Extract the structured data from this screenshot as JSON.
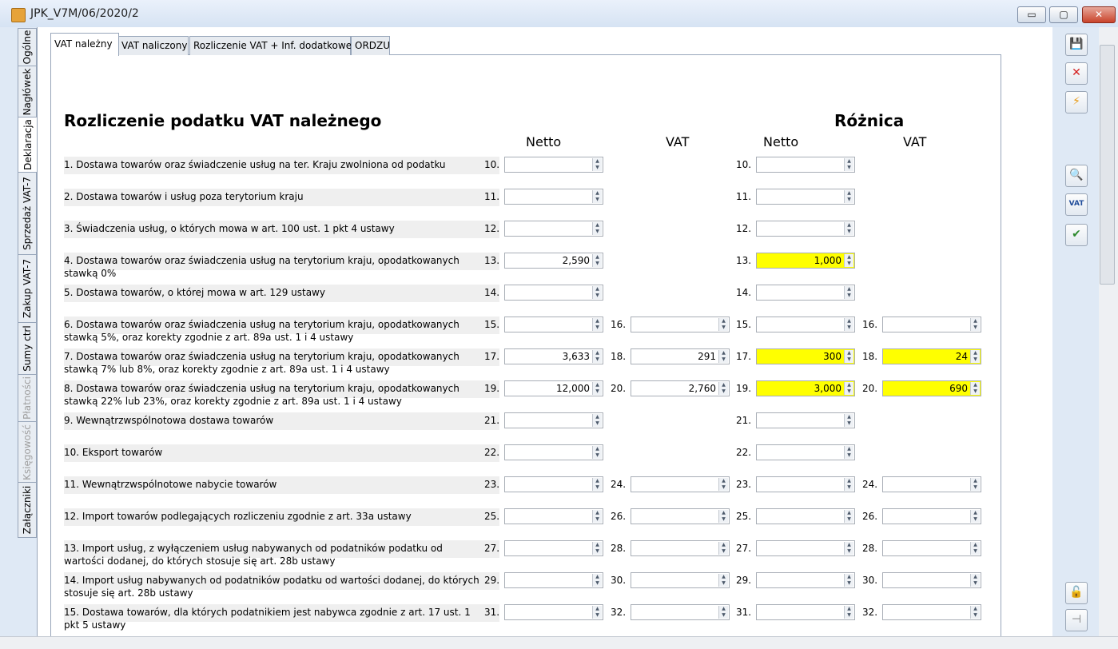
{
  "window": {
    "title": "JPK_V7M/06/2020/2",
    "minimize": "▭",
    "maximize": "▢",
    "close": "✕"
  },
  "left_tabs": [
    {
      "label": "Ogólne"
    },
    {
      "label": "Nagłówek"
    },
    {
      "label": "Deklaracja"
    },
    {
      "label": "Sprzedaż VAT-7"
    },
    {
      "label": "Zakup VAT-7"
    },
    {
      "label": "Sumy ctrl"
    },
    {
      "label": "Płatności"
    },
    {
      "label": "Księgowość"
    },
    {
      "label": "Załączniki"
    }
  ],
  "tabs": [
    {
      "label": "VAT należny"
    },
    {
      "label": "VAT naliczony"
    },
    {
      "label": "Rozliczenie VAT + Inf. dodatkowe"
    },
    {
      "label": "ORDZU"
    }
  ],
  "headings": {
    "left": "Rozliczenie podatku VAT należnego",
    "right": "Różnica"
  },
  "column_headers": {
    "netto": "Netto",
    "vat": "VAT",
    "diff_netto": "Netto",
    "diff_vat": "VAT"
  },
  "rows": [
    {
      "label": "1. Dostawa towarów oraz świadczenie usług na ter. Kraju zwolniona od podatku",
      "n1": "10.",
      "v1": "",
      "n2": "",
      "v2": "",
      "n3": "10.",
      "v3": "",
      "n4": "",
      "v4": ""
    },
    {
      "label": "2. Dostawa towarów i usług poza terytorium kraju",
      "n1": "11.",
      "v1": "",
      "n2": "",
      "v2": "",
      "n3": "11.",
      "v3": "",
      "n4": "",
      "v4": ""
    },
    {
      "label": "3. Świadczenia usług, o których mowa w art. 100 ust. 1 pkt 4 ustawy",
      "n1": "12.",
      "v1": "",
      "n2": "",
      "v2": "",
      "n3": "12.",
      "v3": "",
      "n4": "",
      "v4": ""
    },
    {
      "label": "4. Dostawa towarów oraz świadczenia usług na terytorium kraju,  opodatkowanych stawką 0%",
      "n1": "13.",
      "v1": "2,590",
      "n2": "",
      "v2": "",
      "n3": "13.",
      "v3": "1,000",
      "n4": "",
      "v4": ""
    },
    {
      "label": "5. Dostawa towarów, o której mowa w art. 129 ustawy",
      "n1": "14.",
      "v1": "",
      "n2": "",
      "v2": "",
      "n3": "14.",
      "v3": "",
      "n4": "",
      "v4": ""
    },
    {
      "label": "6. Dostawa towarów oraz świadczenia usług na terytorium kraju, opodatkowanych stawką 5%, oraz korekty zgodnie z art. 89a ust. 1 i 4 ustawy",
      "n1": "15.",
      "v1": "",
      "n2": "16.",
      "v2": "",
      "n3": "15.",
      "v3": "",
      "n4": "16.",
      "v4": ""
    },
    {
      "label": "7. Dostawa towarów oraz świadczenia usług na terytorium kraju, opodatkowanych stawką 7% lub 8%, oraz korekty zgodnie z art. 89a ust. 1 i 4 ustawy",
      "n1": "17.",
      "v1": "3,633",
      "n2": "18.",
      "v2": "291",
      "n3": "17.",
      "v3": "300",
      "n4": "18.",
      "v4": "24"
    },
    {
      "label": "8. Dostawa towarów oraz świadczenia usług na terytorium kraju, opodatkowanych stawką 22% lub 23%, oraz korekty zgodnie z art. 89a ust. 1 i 4 ustawy",
      "n1": "19.",
      "v1": "12,000",
      "n2": "20.",
      "v2": "2,760",
      "n3": "19.",
      "v3": "3,000",
      "n4": "20.",
      "v4": "690"
    },
    {
      "label": "9. Wewnątrzwspólnotowa dostawa towarów",
      "n1": "21.",
      "v1": "",
      "n2": "",
      "v2": "",
      "n3": "21.",
      "v3": "",
      "n4": "",
      "v4": ""
    },
    {
      "label": "10. Eksport towarów",
      "n1": "22.",
      "v1": "",
      "n2": "",
      "v2": "",
      "n3": "22.",
      "v3": "",
      "n4": "",
      "v4": ""
    },
    {
      "label": "11. Wewnątrzwspólnotowe nabycie towarów",
      "n1": "23.",
      "v1": "",
      "n2": "24.",
      "v2": "",
      "n3": "23.",
      "v3": "",
      "n4": "24.",
      "v4": ""
    },
    {
      "label": "12. Import towarów podlegających rozliczeniu zgodnie z art. 33a ustawy",
      "n1": "25.",
      "v1": "",
      "n2": "26.",
      "v2": "",
      "n3": "25.",
      "v3": "",
      "n4": "26.",
      "v4": ""
    },
    {
      "label": "13. Import usług, z wyłączeniem usług nabywanych od podatników podatku od wartości dodanej, do których stosuje się art. 28b ustawy",
      "n1": "27.",
      "v1": "",
      "n2": "28.",
      "v2": "",
      "n3": "27.",
      "v3": "",
      "n4": "28.",
      "v4": ""
    },
    {
      "label": "14. Import usług nabywanych od podatników podatku od wartości dodanej, do których stosuje się art. 28b ustawy",
      "n1": "29.",
      "v1": "",
      "n2": "30.",
      "v2": "",
      "n3": "29.",
      "v3": "",
      "n4": "30.",
      "v4": ""
    },
    {
      "label": "15. Dostawa towarów, dla których podatnikiem jest nabywca zgodnie z art. 17 ust. 1 pkt 5 ustawy",
      "n1": "31.",
      "v1": "",
      "n2": "32.",
      "v2": "",
      "n3": "31.",
      "v3": "",
      "n4": "32.",
      "v4": ""
    }
  ],
  "side_buttons": {
    "save_icon": "💾",
    "cancel_icon": "✕",
    "lightning_icon": "⚡",
    "search_icon": "🔍",
    "vat_icon": "VAT",
    "check_icon": "✔",
    "lock_icon": "🔓",
    "pin_icon": "⊣"
  },
  "colors": {
    "highlight": "#ffff00",
    "row_bg": "#efefef",
    "panel_border": "#98a6ba"
  }
}
